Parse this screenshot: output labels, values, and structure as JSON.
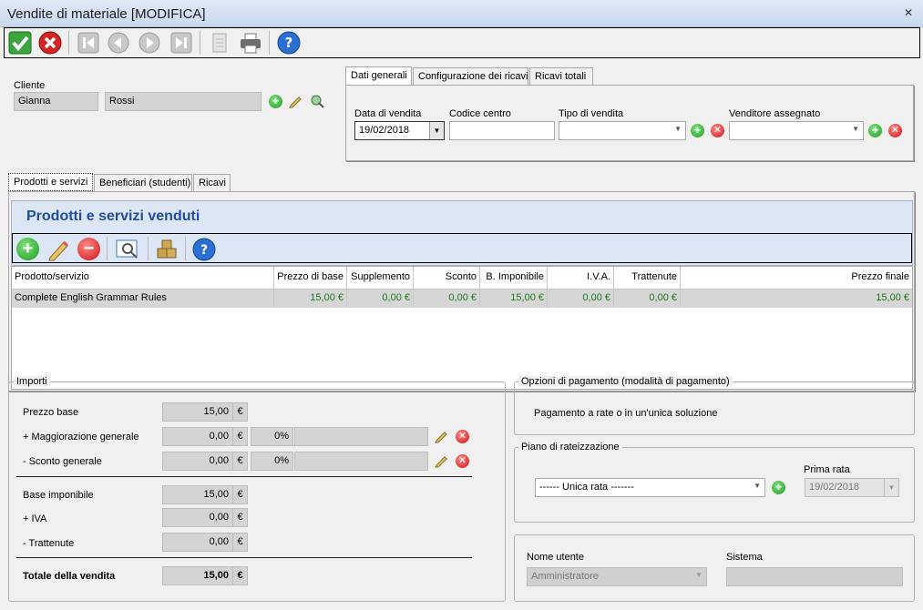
{
  "window": {
    "title": "Vendite di materiale [MODIFICA]"
  },
  "cliente": {
    "label": "Cliente",
    "nome": "Gianna",
    "cognome": "Rossi"
  },
  "top_tabs": [
    "Dati generali",
    "Configurazione dei ricavi",
    "Ricavi totali"
  ],
  "dati_generali": {
    "data_vendita_label": "Data di vendita",
    "data_vendita": "19/02/2018",
    "codice_centro_label": "Codice centro",
    "codice_centro": "",
    "tipo_vendita_label": "Tipo di vendita",
    "tipo_vendita": "",
    "venditore_label": "Venditore assegnato",
    "venditore": ""
  },
  "section_tabs": [
    "Prodotti e servizi",
    "Beneficiari (studenti)",
    "Ricavi"
  ],
  "prodotti": {
    "heading": "Prodotti e servizi venduti",
    "columns": [
      "Prodotto/servizio",
      "Prezzo di base",
      "Supplemento",
      "Sconto",
      "B. Imponibile",
      "I.V.A.",
      "Trattenute",
      "Prezzo finale"
    ],
    "rows": [
      [
        "Complete English Grammar Rules",
        "15,00 €",
        "0,00 €",
        "0,00 €",
        "15,00 €",
        "0,00 €",
        "0,00 €",
        "15,00 €"
      ]
    ]
  },
  "importi": {
    "title": "Importi",
    "currency": "€",
    "prezzo_base_label": "Prezzo base",
    "prezzo_base": "15,00",
    "maggiorazione_label": "+ Maggiorazione generale",
    "maggiorazione": "0,00",
    "maggiorazione_pct": "0%",
    "maggiorazione_note": "",
    "sconto_label": "- Sconto generale",
    "sconto": "0,00",
    "sconto_pct": "0%",
    "sconto_note": "",
    "base_imponibile_label": "Base imponibile",
    "base_imponibile": "15,00",
    "iva_label": "+ IVA",
    "iva": "0,00",
    "trattenute_label": "- Trattenute",
    "trattenute": "0,00",
    "totale_label": "Totale della vendita",
    "totale": "15,00"
  },
  "opzioni_pagamento": {
    "title": "Opzioni di pagamento (modalità di pagamento)",
    "text": "Pagamento a rate o in un'unica soluzione"
  },
  "piano_rateizzazione": {
    "title": "Piano di rateizzazione",
    "selected": "------ Unica rata -------",
    "prima_rata_label": "Prima rata",
    "prima_rata": "19/02/2018"
  },
  "utente": {
    "nome_utente_label": "Nome utente",
    "nome_utente": "Amministratore",
    "sistema_label": "Sistema",
    "sistema": ""
  },
  "colors": {
    "accent_heading": "#1f4e9c",
    "value_green": "#1c7a1c"
  }
}
